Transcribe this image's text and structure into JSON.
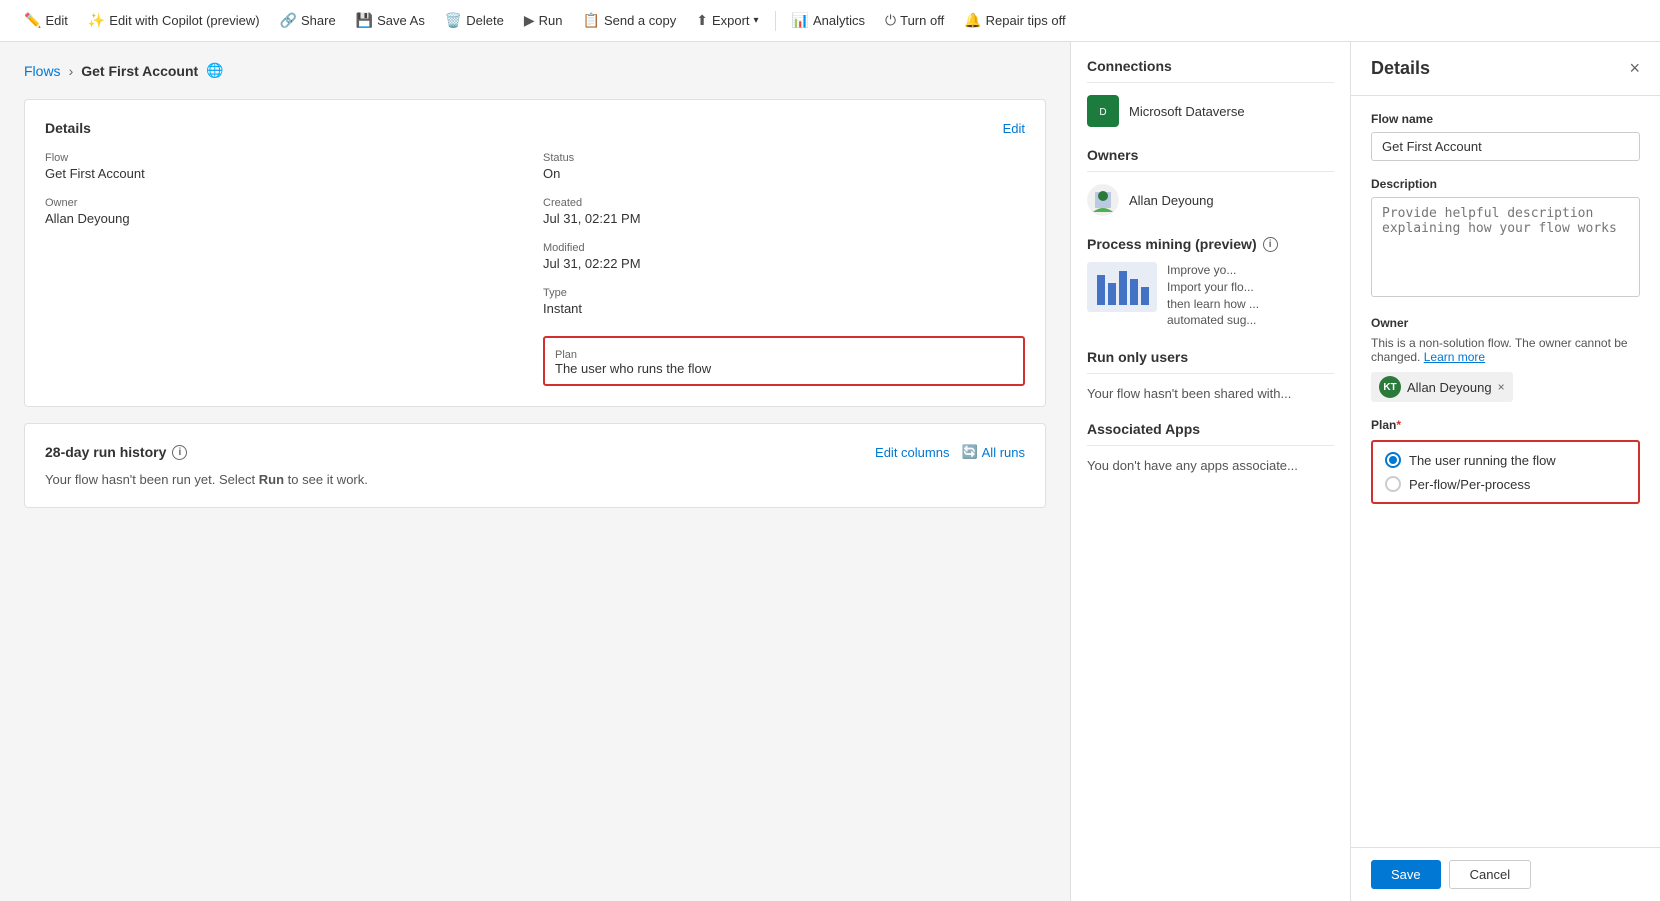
{
  "toolbar": {
    "items": [
      {
        "id": "edit",
        "icon": "✏️",
        "label": "Edit"
      },
      {
        "id": "edit-copilot",
        "icon": "✨",
        "label": "Edit with Copilot (preview)"
      },
      {
        "id": "share",
        "icon": "🔗",
        "label": "Share"
      },
      {
        "id": "save-as",
        "icon": "💾",
        "label": "Save As"
      },
      {
        "id": "delete",
        "icon": "🗑️",
        "label": "Delete"
      },
      {
        "id": "run",
        "icon": "▶",
        "label": "Run"
      },
      {
        "id": "send-copy",
        "icon": "📋",
        "label": "Send a copy"
      },
      {
        "id": "export",
        "icon": "⬆",
        "label": "Export"
      },
      {
        "id": "analytics",
        "icon": "📊",
        "label": "Analytics"
      },
      {
        "id": "turn-off",
        "icon": "⏻",
        "label": "Turn off"
      },
      {
        "id": "repair-tips",
        "icon": "🔔",
        "label": "Repair tips off"
      }
    ]
  },
  "breadcrumb": {
    "parent": "Flows",
    "current": "Get First Account"
  },
  "details_card": {
    "title": "Details",
    "edit_label": "Edit",
    "flow_label": "Flow",
    "flow_value": "Get First Account",
    "owner_label": "Owner",
    "owner_value": "Allan Deyoung",
    "status_label": "Status",
    "status_value": "On",
    "created_label": "Created",
    "created_value": "Jul 31, 02:21 PM",
    "modified_label": "Modified",
    "modified_value": "Jul 31, 02:22 PM",
    "type_label": "Type",
    "type_value": "Instant",
    "plan_label": "Plan",
    "plan_value": "The user who runs the flow"
  },
  "run_history": {
    "title": "28-day run history",
    "edit_columns": "Edit columns",
    "all_runs": "All runs",
    "empty_text": "Your flow hasn't been run yet. Select",
    "run_keyword": "Run",
    "empty_text2": "to see it work."
  },
  "connections": {
    "title": "Connections",
    "items": [
      {
        "name": "Microsoft Dataverse",
        "icon": "🔷"
      }
    ]
  },
  "owners": {
    "title": "Owners",
    "items": [
      {
        "name": "Allan Deyoung"
      }
    ]
  },
  "process_mining": {
    "title": "Process mining (preview)",
    "text1": "Improve yo...",
    "text2": "Import your flo...",
    "text3": "then learn how ...",
    "text4": "automated sug..."
  },
  "run_only_users": {
    "title": "Run only users",
    "text": "Your flow hasn't been shared with..."
  },
  "associated_apps": {
    "title": "Associated Apps",
    "text": "You don't have any apps associate..."
  },
  "details_panel": {
    "title": "Details",
    "close_icon": "×",
    "flow_name_label": "Flow name",
    "flow_name_value": "Get First Account",
    "description_label": "Description",
    "description_placeholder": "Provide helpful description explaining how your flow works",
    "owner_label": "Owner",
    "owner_info": "This is a non-solution flow. The owner cannot be changed.",
    "owner_learn_more": "Learn more",
    "owner_name": "Allan Deyoung",
    "owner_initials": "KT",
    "plan_label": "Plan",
    "plan_required": "*",
    "plan_option1": "The user running the flow",
    "plan_option2": "Per-flow/Per-process",
    "save_label": "Save",
    "cancel_label": "Cancel"
  }
}
